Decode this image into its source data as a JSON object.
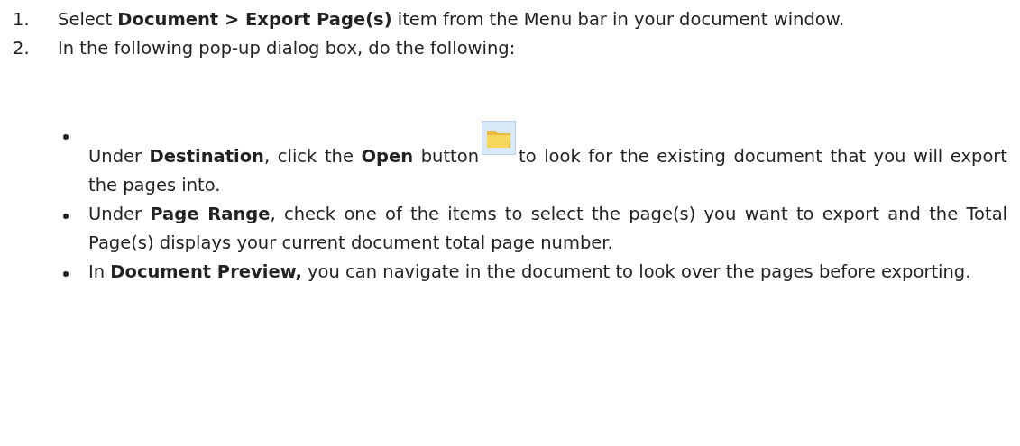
{
  "steps": [
    {
      "number": "1.",
      "text": "Select **Document > Export Page(s)** item from the Menu bar in your document window."
    },
    {
      "number": "2.",
      "text": "In the following pop-up dialog box, do the following:"
    }
  ],
  "bullets": [
    {
      "kind": "icon",
      "text_before": "Under **Destination**, click the **Open** button",
      "text_after": "to look for the existing document that you will export the pages into."
    },
    {
      "kind": "plain",
      "text": "Under **Page Range**, check one of the items to select the page(s) you want to export and the Total Page(s) displays your current document total page number."
    },
    {
      "kind": "plain",
      "text": "In **Document Preview,** you can navigate in the document to look over the pages before exporting."
    }
  ]
}
